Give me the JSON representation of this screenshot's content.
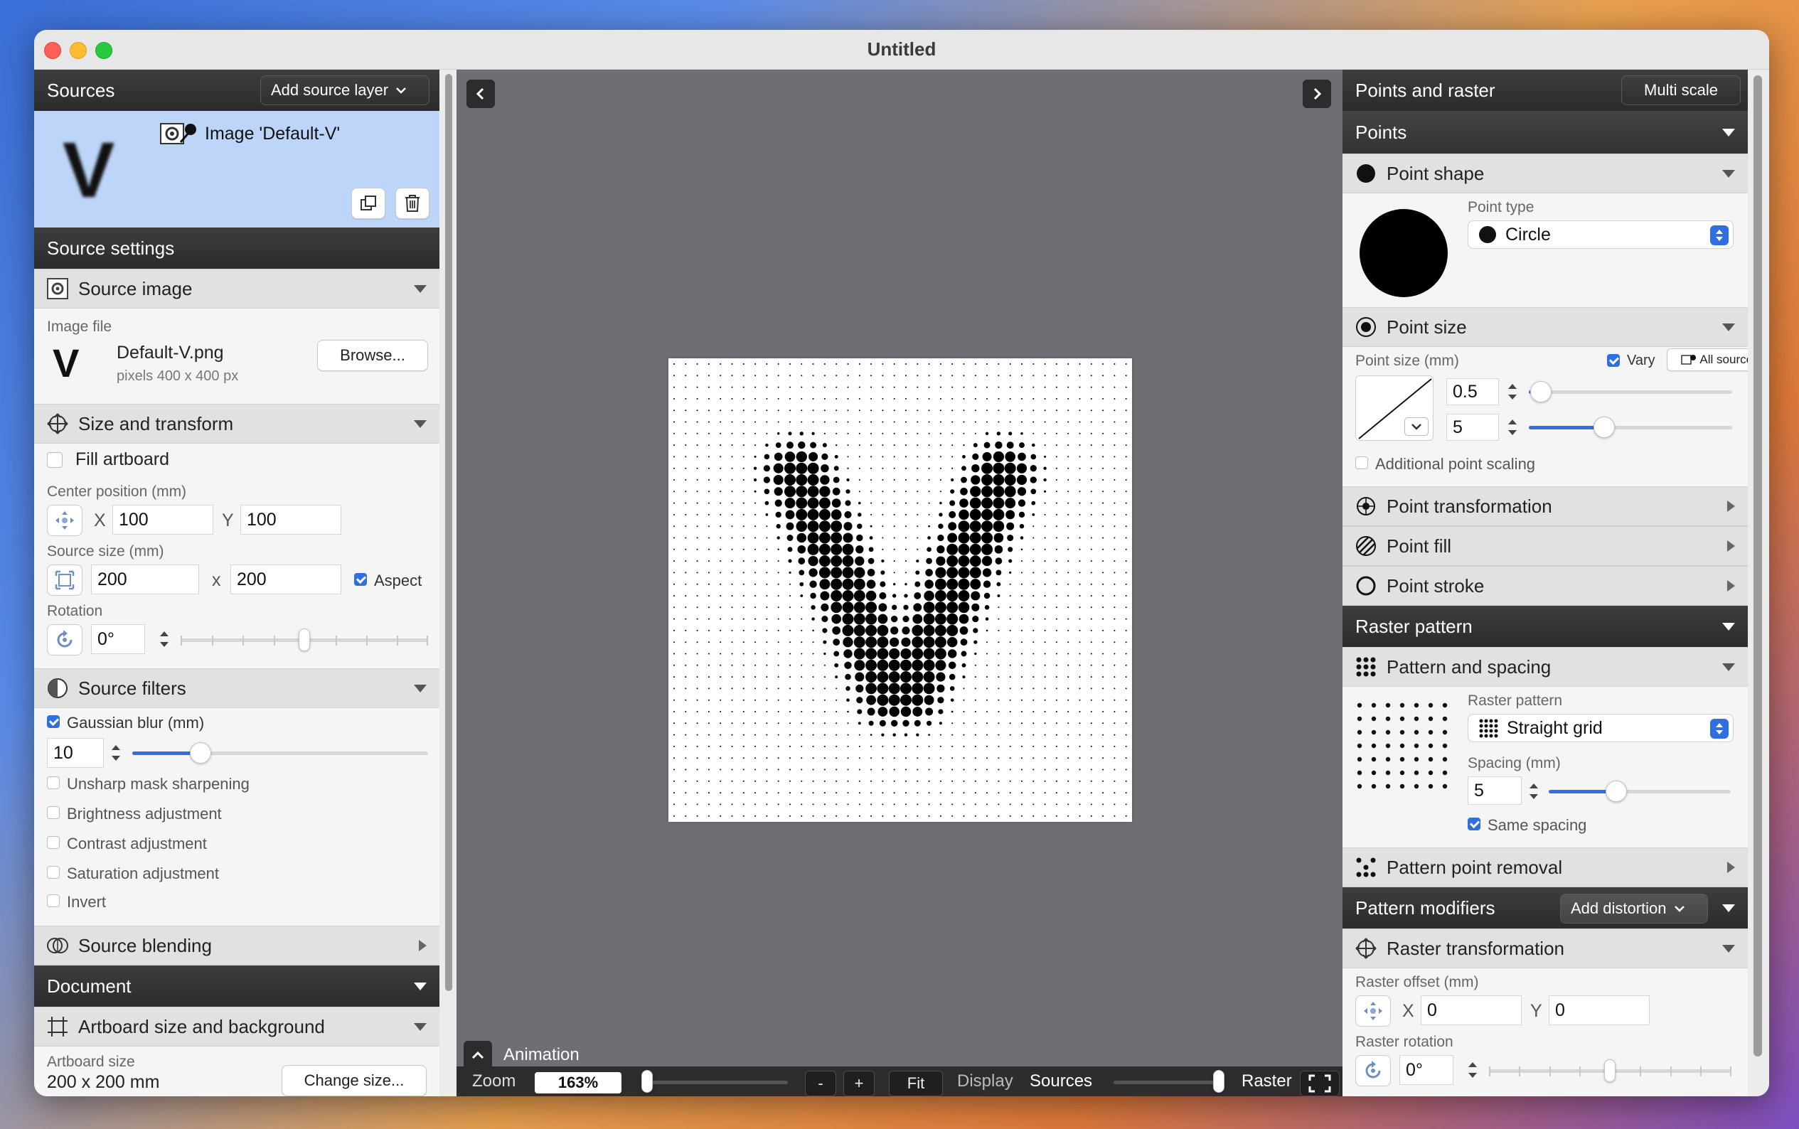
{
  "window": {
    "title": "Untitled"
  },
  "left": {
    "sources_title": "Sources",
    "add_source_label": "Add source layer",
    "source_item_label": "Image 'Default-V'",
    "source_thumb_letter": "V",
    "source_settings_title": "Source settings",
    "source_image": {
      "title": "Source image",
      "image_file_label": "Image file",
      "file_name": "Default-V.png",
      "file_pixels": "pixels 400 x 400 px",
      "browse_label": "Browse..."
    },
    "size_transform": {
      "title": "Size and transform",
      "fill_artboard": "Fill artboard",
      "center_label": "Center position (mm)",
      "x_label": "X",
      "x_value": "100",
      "y_label": "Y",
      "y_value": "100",
      "source_size_label": "Source size (mm)",
      "w_value": "200",
      "times": "x",
      "h_value": "200",
      "aspect_label": "Aspect",
      "rotation_label": "Rotation",
      "rotation_value": "0°"
    },
    "filters": {
      "title": "Source filters",
      "gaussian_label": "Gaussian blur (mm)",
      "gaussian_value": "10",
      "gaussian_level": 0.23,
      "items": [
        "Unsharp mask sharpening",
        "Brightness adjustment",
        "Contrast adjustment",
        "Saturation adjustment",
        "Invert"
      ]
    },
    "blending_title": "Source blending",
    "document_title": "Document",
    "artboard": {
      "title": "Artboard size and background",
      "size_label": "Artboard size",
      "size_value": "200 x 200 mm",
      "change_label": "Change size..."
    }
  },
  "canvas": {
    "animation_label": "Animation",
    "zoom_label": "Zoom",
    "zoom_value": "163%",
    "minus": "-",
    "plus": "+",
    "fit": "Fit",
    "display_label": "Display",
    "sources_label": "Sources",
    "raster_label": "Raster"
  },
  "right": {
    "title": "Points and raster",
    "multi_scale": "Multi scale",
    "points_title": "Points",
    "point_shape": {
      "title": "Point shape",
      "type_label": "Point type",
      "type_value": "Circle"
    },
    "point_size": {
      "title": "Point size",
      "label": "Point size (mm)",
      "vary": "Vary",
      "all_sources": "All sources",
      "min_value": "0.5",
      "max_value": "5",
      "min_level": 0.06,
      "max_level": 0.37,
      "additional": "Additional point scaling"
    },
    "point_transformation": "Point transformation",
    "point_fill": "Point fill",
    "point_stroke": "Point stroke",
    "raster_pattern_title": "Raster pattern",
    "pattern_spacing": {
      "title": "Pattern and spacing",
      "pattern_label": "Raster pattern",
      "pattern_value": "Straight grid",
      "spacing_label": "Spacing (mm)",
      "spacing_value": "5",
      "spacing_level": 0.37,
      "same_spacing": "Same spacing"
    },
    "pattern_point_removal": "Pattern point removal",
    "modifiers_title": "Pattern modifiers",
    "add_distortion": "Add distortion",
    "raster_transformation": {
      "title": "Raster transformation",
      "offset_label": "Raster offset (mm)",
      "x_label": "X",
      "x_value": "0",
      "y_label": "Y",
      "y_value": "0",
      "rotation_label": "Raster rotation",
      "rotation_value": "0°"
    }
  },
  "colors": {
    "accent": "#2f6fe0",
    "selection": "#bcd5f8",
    "dark_header": "#2f2f2f"
  }
}
